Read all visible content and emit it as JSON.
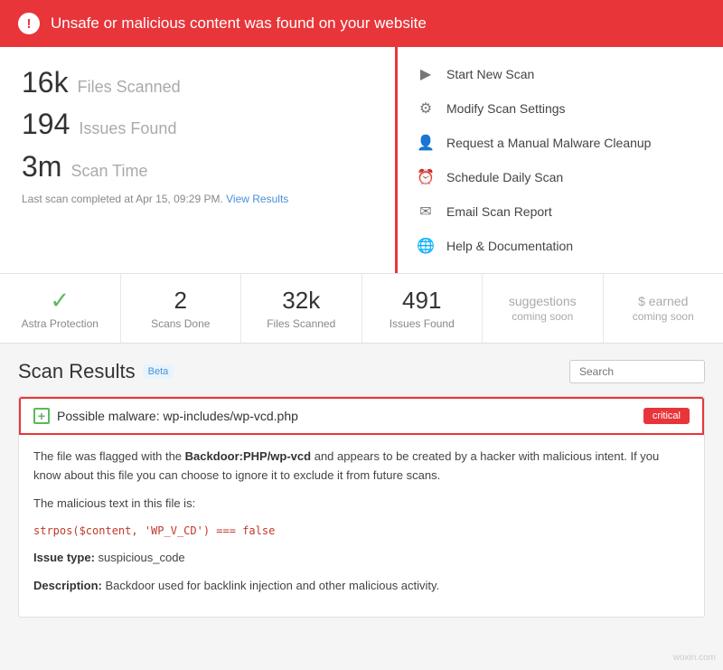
{
  "alert": {
    "text": "Unsafe or malicious content was found on your website"
  },
  "stats": {
    "files_scanned_number": "16k",
    "files_scanned_label": "Files Scanned",
    "issues_found_number": "194",
    "issues_found_label": "Issues Found",
    "scan_time_number": "3m",
    "scan_time_label": "Scan Time",
    "last_scan": "Last scan completed at Apr 15, 09:29 PM.",
    "view_results": "View Results"
  },
  "actions": [
    {
      "id": "start-scan",
      "label": "Start New Scan",
      "icon": "▶"
    },
    {
      "id": "modify-settings",
      "label": "Modify Scan Settings",
      "icon": "⚙"
    },
    {
      "id": "manual-cleanup",
      "label": "Request a Manual Malware Cleanup",
      "icon": "👤"
    },
    {
      "id": "schedule-scan",
      "label": "Schedule Daily Scan",
      "icon": "⏰"
    },
    {
      "id": "email-report",
      "label": "Email Scan Report",
      "icon": "✉"
    },
    {
      "id": "help-docs",
      "label": "Help & Documentation",
      "icon": "🌐"
    }
  ],
  "summary": {
    "items": [
      {
        "id": "astra-protection",
        "value": "✓",
        "label": "Astra Protection",
        "type": "check"
      },
      {
        "id": "scans-done",
        "value": "2",
        "label": "Scans Done",
        "type": "number"
      },
      {
        "id": "files-scanned",
        "value": "32k",
        "label": "Files Scanned",
        "type": "number"
      },
      {
        "id": "issues-found",
        "value": "491",
        "label": "Issues Found",
        "type": "number"
      },
      {
        "id": "suggestions",
        "value": "suggestions",
        "subvalue": "coming soon",
        "label": "",
        "type": "coming"
      },
      {
        "id": "earned",
        "value": "$ earned",
        "subvalue": "coming soon",
        "label": "",
        "type": "coming"
      }
    ]
  },
  "scan_results": {
    "title": "Scan Results",
    "beta": "Beta",
    "search_placeholder": "Search",
    "result": {
      "title": "Possible malware: wp-includes/wp-vcd.php",
      "badge": "critical",
      "description_1": "The file was flagged with the",
      "malware_name": "Backdoor:PHP/wp-vcd",
      "description_2": "and appears to be created by a hacker with malicious intent. If you know about this file you can choose to ignore it to exclude it from future scans.",
      "malicious_text_label": "The malicious text in this file is:",
      "code": "strpos($content, 'WP_V_CD') === false",
      "issue_type_label": "Issue type:",
      "issue_type_value": "suspicious_code",
      "description_label": "Description:",
      "description_value": "Backdoor used for backlink injection and other malicious activity."
    }
  },
  "watermark": "woxin.com"
}
